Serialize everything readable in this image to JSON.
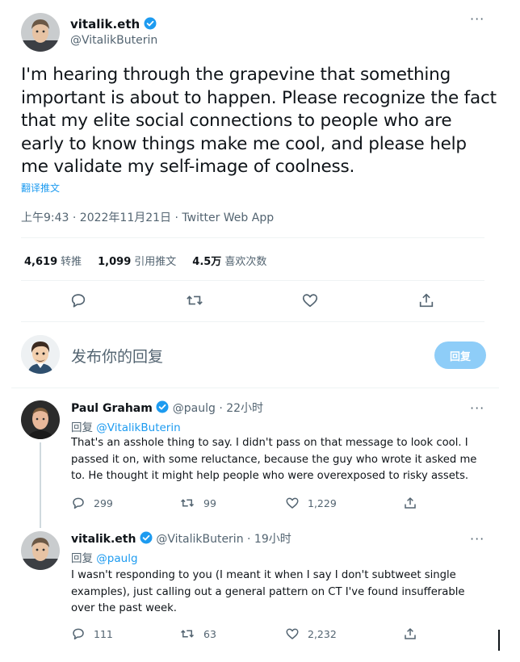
{
  "main": {
    "name": "vitalik.eth",
    "handle": "@VitalikButerin",
    "text": "I'm hearing through the grapevine that something important is about to happen. Please recognize the fact that my elite social connections to people who are early to know things make me cool, and please help me validate my self-image of coolness.",
    "translate": "翻译推文",
    "meta": "上午9:43 · 2022年11月21日 · Twitter Web App",
    "stats": {
      "retweets_count": "4,619",
      "retweets_label": "转推",
      "quotes_count": "1,099",
      "quotes_label": "引用推文",
      "likes_count": "4.5万",
      "likes_label": "喜欢次数"
    }
  },
  "compose": {
    "placeholder": "发布你的回复",
    "button": "回复"
  },
  "replies": [
    {
      "name": "Paul Graham",
      "handle": "@paulg",
      "time": "· 22小时",
      "reply_prefix": "回复",
      "reply_to": "@VitalikButerin",
      "text": "That's an asshole thing to say. I didn't pass on that message to look cool. I passed it on, with some reluctance, because the guy who wrote it asked me to. He thought it might help people who were overexposed to risky assets.",
      "replies": "299",
      "retweets": "99",
      "likes": "1,229"
    },
    {
      "name": "vitalik.eth",
      "handle": "@VitalikButerin",
      "time": "· 19小时",
      "reply_prefix": "回复",
      "reply_to": "@paulg",
      "text": "I wasn't responding to you (I meant it when I say I don't subtweet single examples), just calling out a general pattern on CT I've found insufferable over the past week.",
      "replies": "111",
      "retweets": "63",
      "likes": "2,232"
    }
  ],
  "colors": {
    "accent": "#1d9bf0",
    "muted": "#536471",
    "reply_button": "#8ecdf8"
  }
}
